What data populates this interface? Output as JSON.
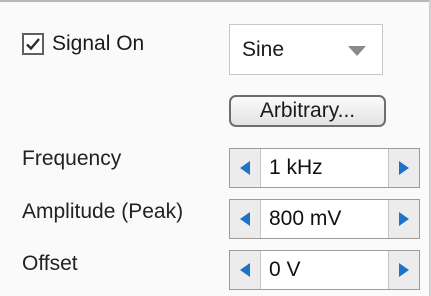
{
  "signal": {
    "checkbox_label": "Signal On",
    "checked": true
  },
  "waveform": {
    "selected": "Sine"
  },
  "arbitrary_button": "Arbitrary...",
  "fields": {
    "frequency": {
      "label": "Frequency",
      "value": "1 kHz"
    },
    "amplitude": {
      "label": "Amplitude (Peak)",
      "value": "800 mV"
    },
    "offset": {
      "label": "Offset",
      "value": "0 V"
    }
  },
  "icons": {
    "checkbox": "checkmark-icon",
    "dropdown": "chevron-down-icon",
    "decrement": "triangle-left-icon",
    "increment": "triangle-right-icon"
  },
  "colors": {
    "arrow_blue": "#1e73c8",
    "dropdown_arrow": "#8a8a8a"
  }
}
